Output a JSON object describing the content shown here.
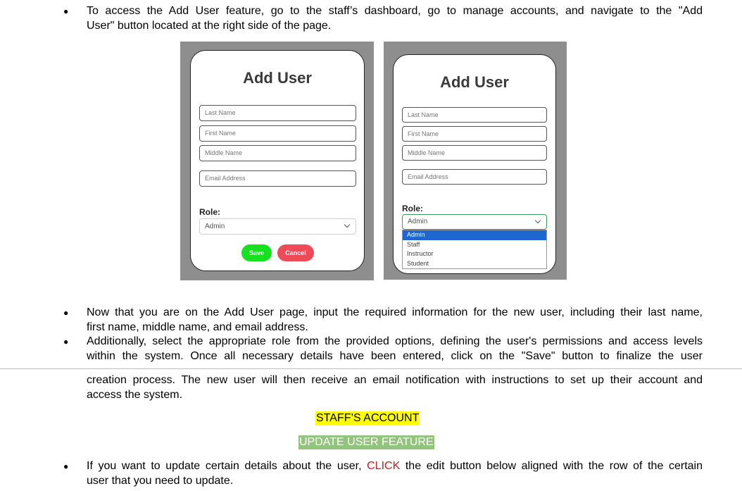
{
  "bullets": [
    {
      "lines": [
        "To access the Add User feature, go to the staff’s dashboard, go to manage accounts, and navigate to the \"Add",
        "User\" button located at the right side of the page."
      ]
    },
    {
      "lines": [
        "Now that you are on the Add User page, input the required information for the new user, including their last name,",
        "first name, middle name, and email address."
      ]
    },
    {
      "lines": [
        "Additionally, select the appropriate role from the provided options, defining the user's permissions and access levels",
        "within the system. Once all necessary details have been entered, click on the \"Save\" button to finalize the user"
      ]
    }
  ],
  "continuation": {
    "lines": [
      "creation process. The new user will then receive an email notification with instructions to set up their account and",
      "access the system."
    ]
  },
  "headings": {
    "staff_account": "STAFF’S ACCOUNT",
    "update_user_feature": "UPDATE USER FEATURE"
  },
  "last_bullet": {
    "before": "If you want to update certain details about the user, ",
    "highlight": "CLICK",
    "after": " the edit button below aligned with the row of the certain",
    "line2": "user that you need to update."
  },
  "bullet_symbol": "●",
  "screenshot_left": {
    "title": "Add User",
    "fields": [
      "Last Name",
      "First Name",
      "Middle Name",
      "Email Address"
    ],
    "role_label": "Role:",
    "role_value": "Admin",
    "save_label": "Save",
    "cancel_label": "Cancel"
  },
  "screenshot_right": {
    "title": "Add User",
    "fields": [
      "Last Name",
      "First Name",
      "Middle Name",
      "Email Address"
    ],
    "role_label": "Role:",
    "role_value": "Admin",
    "options": [
      "Admin",
      "Staff",
      "Instructor",
      "Student"
    ],
    "selected_option": "Admin"
  },
  "colors": {
    "save": "#15e11f",
    "cancel": "#ef4a58",
    "yellow_highlight": "#ffff00",
    "green_highlight": "#93c47d",
    "click_red": "#d01919",
    "dropdown_selected": "#1e66d0"
  }
}
